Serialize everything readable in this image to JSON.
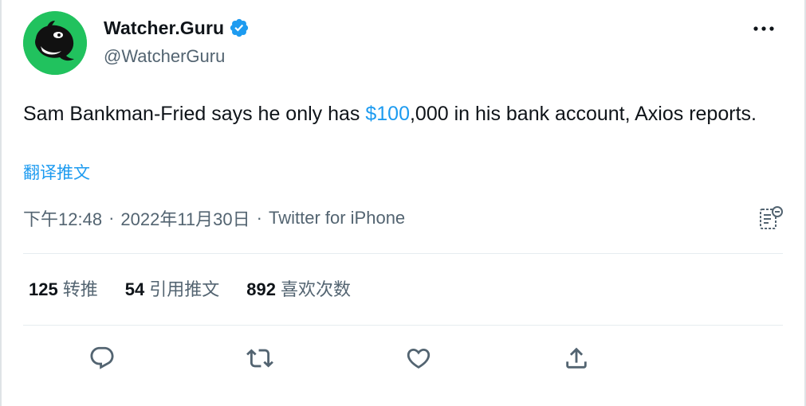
{
  "author": {
    "display_name": "Watcher.Guru",
    "handle": "@WatcherGuru",
    "verified": true,
    "avatar_color": "#21c25e"
  },
  "tweet": {
    "text_before": "Sam Bankman-Fried says he only has ",
    "cashtag": "$100",
    "text_after": ",000 in his bank account, Axios reports.",
    "translate_label": "翻译推文"
  },
  "meta": {
    "time": "下午12:48",
    "separator": "·",
    "date": "2022年11月30日",
    "source": "Twitter for iPhone"
  },
  "stats": [
    {
      "count": "125",
      "label": "转推"
    },
    {
      "count": "54",
      "label": "引用推文"
    },
    {
      "count": "892",
      "label": "喜欢次数"
    }
  ],
  "colors": {
    "accent": "#1d9bf0",
    "text_primary": "#0f1419",
    "text_secondary": "#536471",
    "divider": "#e6ecf0"
  },
  "icons": {
    "more": "more-horizontal-icon",
    "verified": "verified-badge-icon",
    "analytics": "tweet-analytics-icon",
    "reply": "reply-icon",
    "retweet": "retweet-icon",
    "like": "heart-icon",
    "share": "share-icon"
  }
}
